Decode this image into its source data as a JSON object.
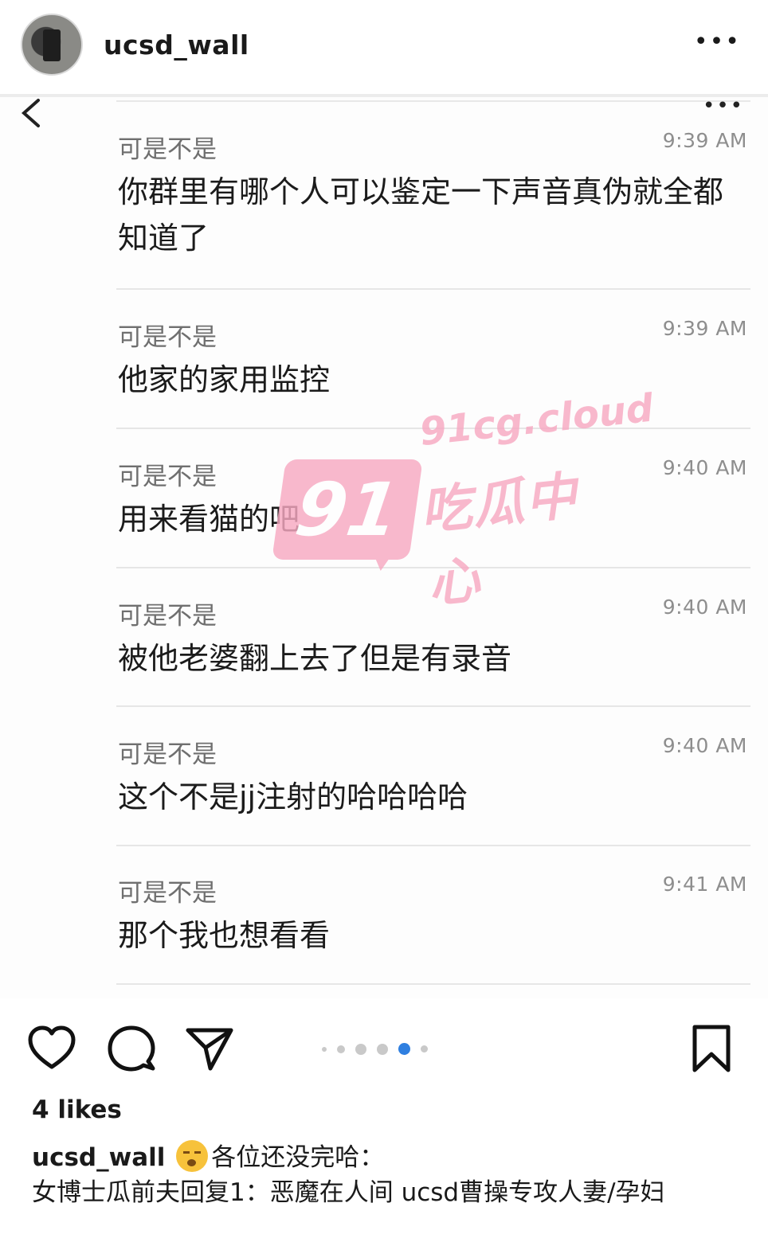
{
  "header": {
    "username": "ucsd_wall",
    "more_icon": "more-horizontal-icon"
  },
  "screenshot": {
    "back_icon": "chevron-left-icon",
    "more_icon": "more-horizontal-icon",
    "messages": [
      {
        "sender": "可是不是",
        "time": "9:39 AM",
        "text": "你群里有哪个人可以鉴定一下声音真伪就全都知道了"
      },
      {
        "sender": "可是不是",
        "time": "9:39 AM",
        "text": "他家的家用监控"
      },
      {
        "sender": "可是不是",
        "time": "9:40 AM",
        "text": "用来看猫的吧"
      },
      {
        "sender": "可是不是",
        "time": "9:40 AM",
        "text": "被他老婆翻上去了但是有录音"
      },
      {
        "sender": "可是不是",
        "time": "9:40 AM",
        "text": "这个不是jj注射的哈哈哈哈"
      },
      {
        "sender": "可是不是",
        "time": "9:41 AM",
        "text": "那个我也想看看"
      }
    ]
  },
  "watermark": {
    "logo": "91",
    "domain": "91cg.cloud",
    "text": "吃瓜中心"
  },
  "actions": {
    "like_icon": "heart-icon",
    "comment_icon": "comment-icon",
    "share_icon": "paper-plane-icon",
    "save_icon": "bookmark-icon",
    "carousel_total": 6,
    "carousel_active": 5
  },
  "likes": "4 likes",
  "caption": {
    "username": "ucsd_wall",
    "emoji": "face-with-steam-emoji",
    "text": "各位还没完哈：\n女博士瓜前夫回复1：恶魔在人间 ucsd曹操专攻人妻/孕妇"
  },
  "colors": {
    "watermark_pink": "#f7a9c2",
    "carousel_active": "#2f7fe0"
  }
}
